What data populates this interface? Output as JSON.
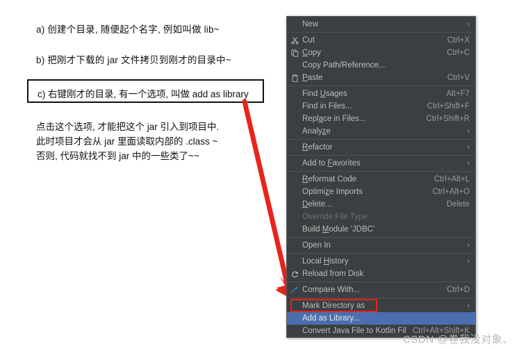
{
  "notes": {
    "line_a": "a) 创建个目录, 随便起个名字, 例如叫做 lib~",
    "line_b": "b) 把刚才下载的 jar 文件拷贝到刚才的目录中~",
    "boxed_line": "c) 右键刚才的目录, 有一个选项, 叫做 add as library",
    "paragraph": [
      "点击这个选项, 才能把这个 jar 引入到项目中.",
      "此时项目才会从 jar 里面读取内部的 .class ~",
      "否则, 代码就找不到 jar 中的一些类了~~"
    ]
  },
  "context_menu": {
    "items": [
      {
        "label": "New",
        "accel": "",
        "submenu": true,
        "icon": "",
        "disabled": false,
        "selected": false
      },
      {
        "type": "separator"
      },
      {
        "label": "Cut",
        "accel": "Ctrl+X",
        "submenu": false,
        "icon": "scissors-icon",
        "disabled": false,
        "selected": false
      },
      {
        "label": "Copy",
        "accel": "Ctrl+C",
        "submenu": false,
        "icon": "copy-icon",
        "disabled": false,
        "selected": false,
        "mnemonic": "C"
      },
      {
        "label": "Copy Path/Reference...",
        "accel": "",
        "submenu": false,
        "icon": "",
        "disabled": false,
        "selected": false
      },
      {
        "label": "Paste",
        "accel": "Ctrl+V",
        "submenu": false,
        "icon": "clipboard-icon",
        "disabled": false,
        "selected": false,
        "mnemonic": "P"
      },
      {
        "type": "separator"
      },
      {
        "label": "Find Usages",
        "accel": "Alt+F7",
        "submenu": false,
        "icon": "",
        "disabled": false,
        "selected": false,
        "mnemonic": "U"
      },
      {
        "label": "Find in Files...",
        "accel": "Ctrl+Shift+F",
        "submenu": false,
        "icon": "",
        "disabled": false,
        "selected": false
      },
      {
        "label": "Replace in Files...",
        "accel": "Ctrl+Shift+R",
        "submenu": false,
        "icon": "",
        "disabled": false,
        "selected": false,
        "mnemonic": "a"
      },
      {
        "label": "Analyze",
        "accel": "",
        "submenu": true,
        "icon": "",
        "disabled": false,
        "selected": false,
        "mnemonic": "z"
      },
      {
        "type": "separator"
      },
      {
        "label": "Refactor",
        "accel": "",
        "submenu": true,
        "icon": "",
        "disabled": false,
        "selected": false,
        "mnemonic": "R"
      },
      {
        "type": "separator"
      },
      {
        "label": "Add to Favorites",
        "accel": "",
        "submenu": true,
        "icon": "",
        "disabled": false,
        "selected": false,
        "mnemonic": "F"
      },
      {
        "type": "separator"
      },
      {
        "label": "Reformat Code",
        "accel": "Ctrl+Alt+L",
        "submenu": false,
        "icon": "",
        "disabled": false,
        "selected": false,
        "mnemonic": "R"
      },
      {
        "label": "Optimize Imports",
        "accel": "Ctrl+Alt+O",
        "submenu": false,
        "icon": "",
        "disabled": false,
        "selected": false,
        "mnemonic": "z"
      },
      {
        "label": "Delete...",
        "accel": "Delete",
        "submenu": false,
        "icon": "",
        "disabled": false,
        "selected": false,
        "mnemonic": "D"
      },
      {
        "label": "Override File Type",
        "accel": "",
        "submenu": false,
        "icon": "",
        "disabled": true,
        "selected": false
      },
      {
        "label": "Build Module 'JDBC'",
        "accel": "",
        "submenu": false,
        "icon": "",
        "disabled": false,
        "selected": false,
        "mnemonic": "M"
      },
      {
        "type": "separator"
      },
      {
        "label": "Open In",
        "accel": "",
        "submenu": true,
        "icon": "",
        "disabled": false,
        "selected": false
      },
      {
        "type": "separator"
      },
      {
        "label": "Local History",
        "accel": "",
        "submenu": true,
        "icon": "",
        "disabled": false,
        "selected": false,
        "mnemonic": "H"
      },
      {
        "label": "Reload from Disk",
        "accel": "",
        "submenu": false,
        "icon": "reload-icon",
        "disabled": false,
        "selected": false
      },
      {
        "type": "separator"
      },
      {
        "label": "Compare With...",
        "accel": "Ctrl+D",
        "submenu": false,
        "icon": "compare-icon",
        "disabled": false,
        "selected": false
      },
      {
        "type": "separator"
      },
      {
        "label": "Mark Directory as",
        "accel": "",
        "submenu": true,
        "icon": "",
        "disabled": false,
        "selected": false
      },
      {
        "label": "Add as Library...",
        "accel": "",
        "submenu": false,
        "icon": "",
        "disabled": false,
        "selected": true
      },
      {
        "label": "Convert Java File to Kotlin File",
        "accel": "Ctrl+Alt+Shift+K",
        "submenu": false,
        "icon": "",
        "disabled": false,
        "selected": false
      }
    ]
  },
  "watermark": "CSDN @卷我没对象、",
  "colors": {
    "menu_bg": "#3c3f41",
    "menu_text": "#bbbbbb",
    "menu_disabled": "#6e7173",
    "selection_bg": "#4b6eaf",
    "separator": "#4f5254",
    "annotation_red": "#e8241c",
    "icon_blue": "#3d87d6",
    "watermark": "#b9b9b9"
  }
}
